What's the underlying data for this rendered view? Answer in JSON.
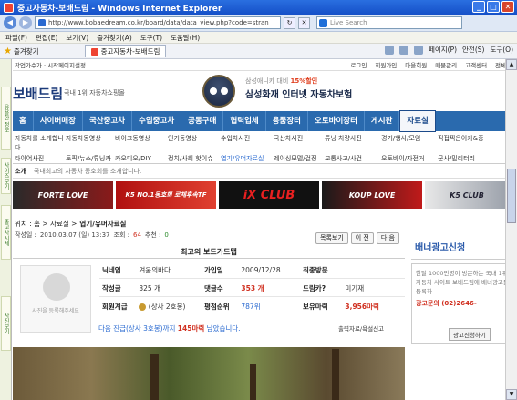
{
  "window": {
    "title": "중고자동차-보배드림 - Windows Internet Explorer"
  },
  "address": {
    "url": "http://www.bobaedream.co.kr/board/data/data_view.php?code=stran",
    "search_placeholder": "Live Search"
  },
  "menu": [
    "파일(F)",
    "편집(E)",
    "보기(V)",
    "즐겨찾기(A)",
    "도구(T)",
    "도움말(H)"
  ],
  "favorites": {
    "label": "즐겨찾기",
    "tab_label": "중고자동차-보배드림"
  },
  "commands": [
    "페이지(P)",
    "안전(S)",
    "도구(O)"
  ],
  "site": {
    "toplinks_left": "작업가수가 · 시작페이지설정",
    "toplinks_right": [
      "로그인",
      "회원가입",
      "마을회원",
      "매물관리",
      "고객센터",
      "전체메"
    ],
    "logo": "보배드림",
    "logo_sub": "국내 1위 자동차쇼핑몰",
    "ad_top": "삼성애니카 대비",
    "ad_top_highlight": "15%할인",
    "ad_main": "삼성화재 인터넷 자동차보험"
  },
  "nav": [
    "홈",
    "사이버매장",
    "국산중고차",
    "수입중고차",
    "공동구매",
    "협력업체",
    "용품장터",
    "오토바이장터",
    "게시판",
    "자료실"
  ],
  "nav_active_index": 9,
  "subnav": [
    [
      "자동차를 소개합니다",
      "자동차동영상",
      "바이크동영상",
      "인기동영상",
      "수입차사진",
      "국산차사진",
      "튜닝 차량사진",
      "경기/행사/모임",
      "직접찍은이카&종"
    ],
    [
      "타이어사진",
      "토픽/뉴스/튜닝카",
      "카오디오/DIY",
      "정치/사회 핫이슈",
      "엽기/유머자료실",
      "레이싱모델/걸정",
      "교통사고/사건",
      "오토바이/자전거",
      "군사/밀리터리"
    ]
  ],
  "notice": {
    "label": "소개",
    "text": "국내최고의 자동차 동호회를 소개합니다."
  },
  "banners": [
    "FORTE LOVE",
    "K5 NO.1동호회 로체후속TF",
    "iX CLUB",
    "KOUP LOVE",
    "K5 CLUB"
  ],
  "breadcrumb": {
    "prefix": "위치 : 홈 > 자료실 >",
    "current": "엽기/유머자료실"
  },
  "meta": {
    "date_label": "작성일 :",
    "date": "2010.03.07 (일) 13:37",
    "views_label": "조회 :",
    "views": "64",
    "votes_label": "추천 :",
    "votes": "0"
  },
  "buttons": [
    "목록보기",
    "이 전",
    "다 음"
  ],
  "card_title": "최고의 보드가드탭",
  "profile": {
    "avatar_text": "사진을 등록해주세요",
    "nickname_label": "닉네임",
    "nickname": "겨울의바다",
    "joined_label": "가입일",
    "joined": "2009/12/28",
    "last_visit_label": "최종방문",
    "last_visit": "",
    "posts_label": "작성글",
    "posts": "325 개",
    "comments_label": "댓글수",
    "comments": "353 개",
    "drama_label": "드림카?",
    "drama": "미기재",
    "level_label": "회원계급",
    "level": "(상사 2호봉)",
    "score_label": "평점순위",
    "score": "787위",
    "mileage_label": "보유마력",
    "mileage": "3,956마력"
  },
  "footline": {
    "prefix": "다음 진급(상사 3호봉)까지",
    "amount": "145마력",
    "suffix": "남았습니다."
  },
  "footright": "출력자료/욕설신고",
  "right": {
    "title": "배너광고신청",
    "desc": "한달 1000만명이 방문하는 국내 1위 자동차 사이트 보배드림에 배너광고를 등록하",
    "phone": "광고문의 (02)2646-",
    "button": "광고신청하기"
  },
  "side_labels": [
    "유용한 정보",
    "사이즈보기",
    "중고차시세",
    "사진보기"
  ],
  "colors": {
    "nav": "#2a6aae",
    "accent": "#d03020",
    "link": "#2a6ad0"
  }
}
